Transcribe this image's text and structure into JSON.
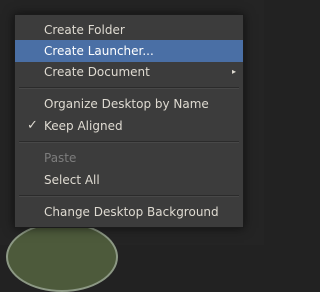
{
  "context_menu": {
    "items": [
      {
        "label": "Create Folder"
      },
      {
        "label": "Create Launcher..."
      },
      {
        "label": "Create Document",
        "submenu_arrow": "▸"
      },
      {
        "label": "Organize Desktop by Name"
      },
      {
        "label": "Keep Aligned",
        "check": "✓"
      },
      {
        "label": "Paste"
      },
      {
        "label": "Select All"
      },
      {
        "label": "Change Desktop Background"
      }
    ]
  },
  "colors": {
    "menu_background": "#3c3c3c",
    "highlight": "#4a6fa5",
    "text": "#dfdbd2",
    "disabled_text": "#7d7d7d",
    "desktop_background": "#242424"
  },
  "icons": {
    "submenu": "chevron-right-icon",
    "checkmark": "check-icon"
  }
}
